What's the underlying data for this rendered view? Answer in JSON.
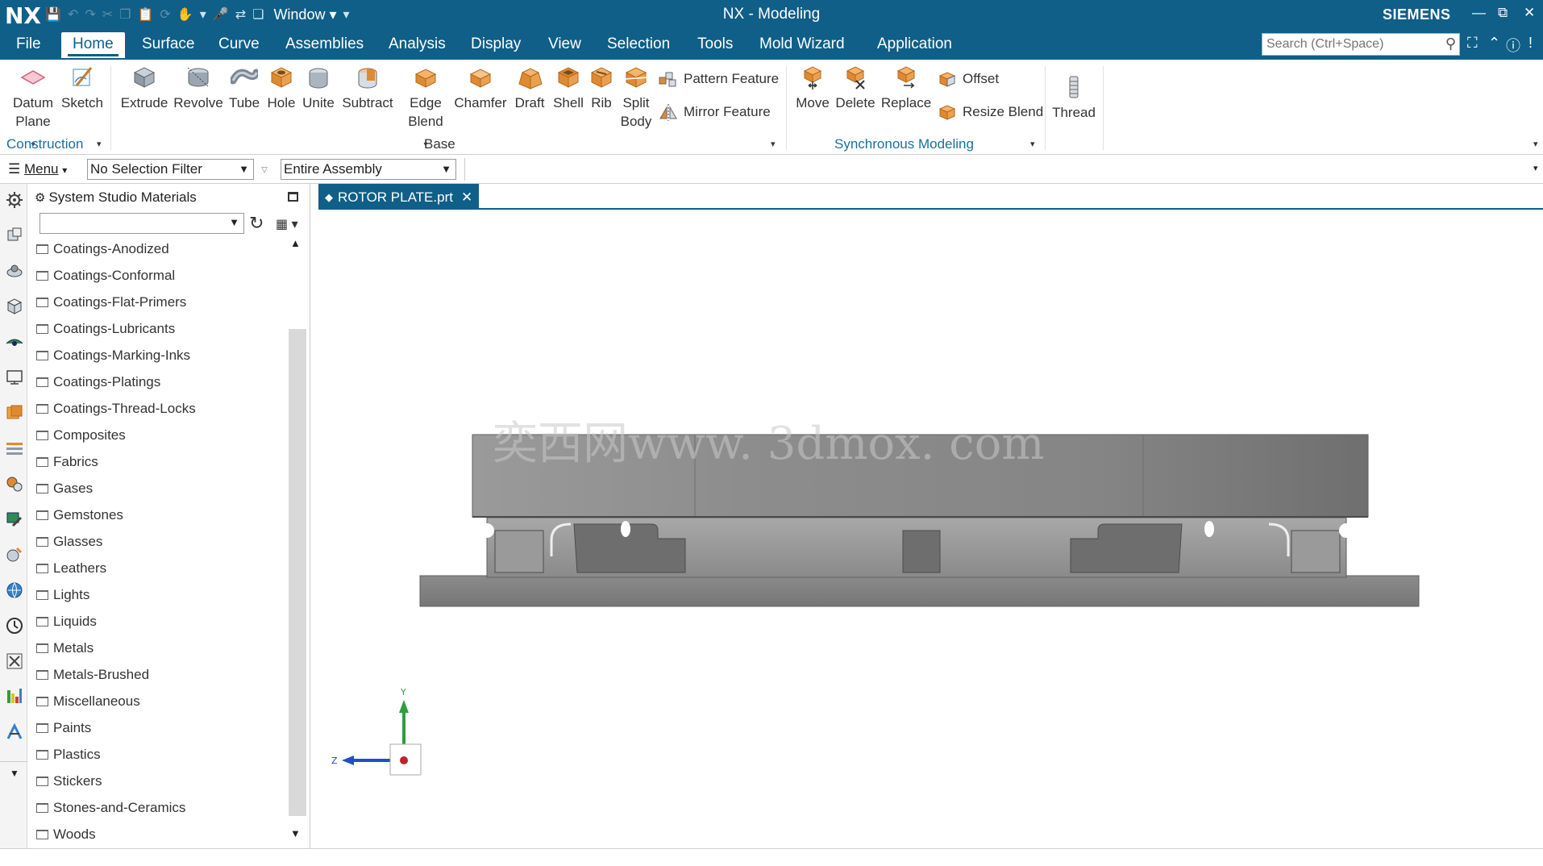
{
  "titlebar": {
    "logo": "NX",
    "window_menu": "Window",
    "title": "NX - Modeling",
    "brand": "SIEMENS"
  },
  "menu_tabs": [
    "File",
    "Home",
    "Surface",
    "Curve",
    "Assemblies",
    "Analysis",
    "Display",
    "View",
    "Selection",
    "Tools",
    "Mold Wizard",
    "Application"
  ],
  "active_tab": "Home",
  "search": {
    "placeholder": "Search (Ctrl+Space)"
  },
  "ribbon": {
    "construction": {
      "label": "Construction",
      "datum_plane": "Datum Plane",
      "sketch": "Sketch"
    },
    "base": {
      "label": "Base",
      "extrude": "Extrude",
      "revolve": "Revolve",
      "tube": "Tube",
      "hole": "Hole",
      "unite": "Unite",
      "subtract": "Subtract",
      "edge_blend": "Edge Blend",
      "chamfer": "Chamfer",
      "draft": "Draft",
      "shell": "Shell",
      "rib": "Rib",
      "split_body": "Split Body",
      "pattern_feature": "Pattern Feature",
      "mirror_feature": "Mirror Feature"
    },
    "synchronous": {
      "label": "Synchronous Modeling",
      "move": "Move",
      "delete": "Delete",
      "replace": "Replace",
      "offset": "Offset",
      "resize_blend": "Resize Blend"
    },
    "thread": "Thread"
  },
  "selection_bar": {
    "menu": "Menu",
    "selection_filter": "No Selection Filter",
    "scope": "Entire Assembly"
  },
  "panel": {
    "title": "System Studio Materials",
    "materials": [
      "Coatings-Anodized",
      "Coatings-Conformal",
      "Coatings-Flat-Primers",
      "Coatings-Lubricants",
      "Coatings-Marking-Inks",
      "Coatings-Platings",
      "Coatings-Thread-Locks",
      "Composites",
      "Fabrics",
      "Gases",
      "Gemstones",
      "Glasses",
      "Leathers",
      "Lights",
      "Liquids",
      "Metals",
      "Metals-Brushed",
      "Miscellaneous",
      "Paints",
      "Plastics",
      "Stickers",
      "Stones-and-Ceramics",
      "Woods"
    ]
  },
  "document_tab": "ROTOR PLATE.prt",
  "viewport": {
    "watermark": "奕西网www. 3dmox. com",
    "triad": {
      "y_label": "Y",
      "z_label": "Z"
    }
  },
  "colors": {
    "brand_blue": "#0f5f88",
    "panel_border": "#c8c8c8",
    "triad_y": "#2e9e3e",
    "triad_z": "#1f4fc2",
    "triad_origin": "#c0202a"
  }
}
